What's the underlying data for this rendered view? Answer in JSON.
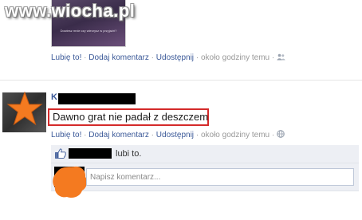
{
  "watermark": "www.wiocha.pl",
  "previous_post": {
    "image_caption": "Dowiesz mnie czy wierzysz w przyjaźń?",
    "actions": {
      "like": "Lubię to!",
      "comment": "Dodaj komentarz",
      "share": "Udostępnij",
      "time": "około godziny temu",
      "audience_icon": "friends-icon"
    }
  },
  "post": {
    "author_initial": "K",
    "status_text": "Dawno grat nie padał z deszczem",
    "actions": {
      "like": "Lubię to!",
      "comment": "Dodaj komentarz",
      "share": "Udostępnij",
      "time": "około godziny temu",
      "audience_icon": "globe-icon"
    },
    "likes_text": "lubi to.",
    "comment_placeholder": "Napisz komentarz..."
  },
  "colors": {
    "link": "#3b5998",
    "highlight_border": "#d42a2a",
    "overlay_orange": "#f47a20",
    "ufi_background": "#edeff4"
  }
}
